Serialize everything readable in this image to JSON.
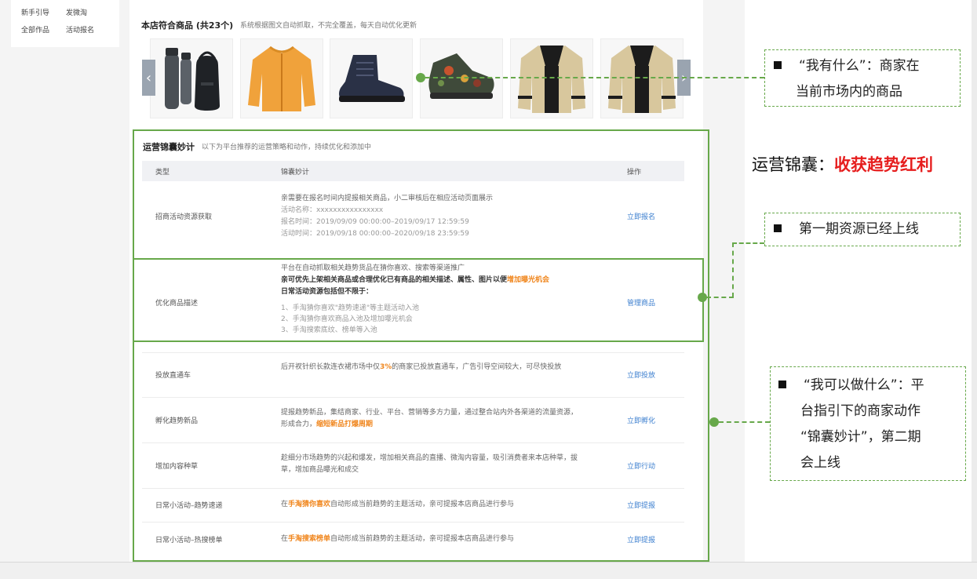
{
  "left_nav": {
    "links": [
      "新手引导",
      "发微淘",
      "全部作品",
      "活动报名"
    ]
  },
  "products": {
    "title": "本店符合商品 (共23个)",
    "subtitle": "系统根据图文自动抓取，不完全覆盖，每天自动优化更新",
    "items": [
      {
        "icon": "thermos-bottle-icon"
      },
      {
        "icon": "orange-jacket-icon"
      },
      {
        "icon": "dark-boot-icon"
      },
      {
        "icon": "floral-sneaker-icon"
      },
      {
        "icon": "cardigan-icon"
      },
      {
        "icon": "cardigan-icon"
      }
    ],
    "prev_icon": "chevron-left-icon",
    "next_icon": "chevron-right-icon"
  },
  "ops": {
    "title": "运营锦囊妙计",
    "subtitle": "以下为平台推荐的运营策略和动作，持续优化和添加中",
    "columns": [
      "类型",
      "锦囊妙计",
      "操作"
    ],
    "rows": [
      {
        "type": "招商活动资源获取",
        "lines": [
          "亲需要在报名时间内提报相关商品，小二审核后在相应活动页面展示",
          "活动名称：xxxxxxxxxxxxxxxx",
          "报名时间：2019/09/09 00:00:00–2019/09/17 12:59:59",
          "活动时间：2019/09/18 00:00:00–2020/09/18 23:59:59"
        ],
        "action": "立即报名"
      },
      {
        "type": "优化商品描述",
        "line1": "平台在自动抓取相关趋势货品在猜你喜欢、搜索等渠道推广",
        "line2_pre": "亲可优先上架相关商品或合理优化已有商品的相关描述、属性、图片以便",
        "line2_hl": "增加曝光机会",
        "line3": "日常活动资源包括但不限于：",
        "items": [
          "1、手淘猜你喜欢\"趋势速递\"等主题活动入池",
          "2、手淘猜你喜欢商品入池及增加曝光机会",
          "3、手淘搜索底纹、榜单等入池"
        ],
        "action": "管理商品"
      },
      {
        "type": "投放直通车",
        "pre": "后开衩针织长款连衣裙市场中仅",
        "hl": "3%",
        "post": "的商家已投放直通车，广告引导空间较大，可尽快投放",
        "action": "立即投放"
      },
      {
        "type": "孵化趋势新品",
        "pre": "提报趋势新品，集结商家、行业、平台、营销等多方力量，通过整合站内外各渠道的流量资源，形成合力，",
        "hl": "缩短新品打爆周期",
        "post": "",
        "action": "立即孵化"
      },
      {
        "type": "增加内容种草",
        "pre": "趁细分市场趋势的兴起和爆发，增加相关商品的直播、微淘内容量，吸引消费者来本店种草，拔草，增加商品曝光和成交",
        "action": "立即行动"
      },
      {
        "type": "日常小活动–趋势速递",
        "pre": "在",
        "hl": "手淘猜你喜欢",
        "post": "自动形成当前趋势的主题活动，亲可提报本店商品进行参与",
        "action": "立即提报"
      },
      {
        "type": "日常小活动–热搜榜单",
        "pre": "在",
        "hl": "手淘搜索榜单",
        "post": "自动形成当前趋势的主题活动，亲可提报本店商品进行参与",
        "action": "立即提报"
      }
    ]
  },
  "annotations": {
    "callout1": [
      "“我有什么”：商家在",
      "当前市场内的商品"
    ],
    "headline_black": "运营锦囊：",
    "headline_red": "收获趋势红利",
    "callout2": [
      "第一期资源已经上线"
    ],
    "callout3": [
      "“我可以做什么”：平",
      "台指引下的商家动作",
      "“锦囊妙计”，第二期",
      "会上线"
    ]
  },
  "colors": {
    "annotation_green": "#67a84a",
    "highlight_orange": "#f0861d",
    "link_blue": "#3c7fcf",
    "headline_red": "#e61e1e"
  }
}
